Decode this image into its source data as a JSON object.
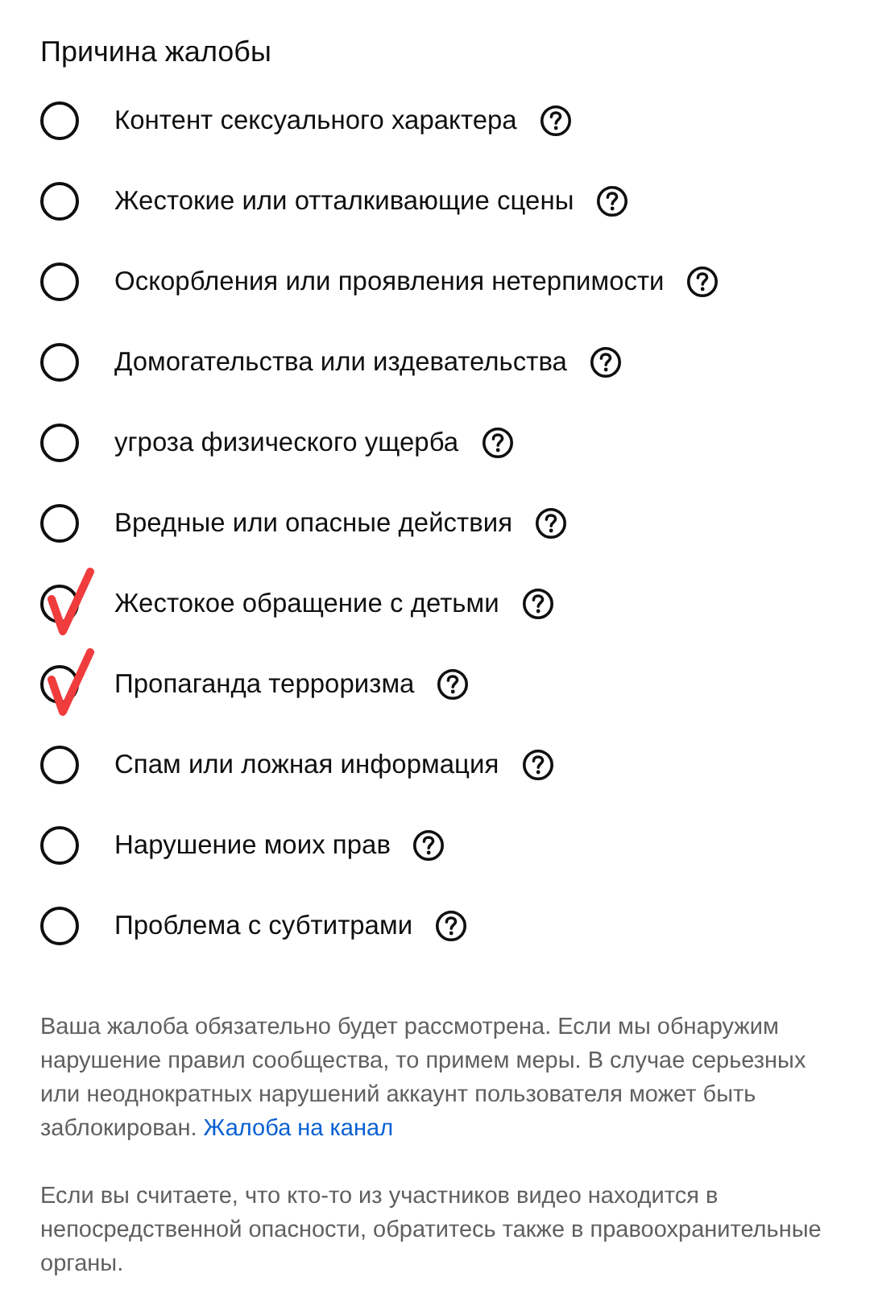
{
  "title": "Причина жалобы",
  "reasons": [
    {
      "label": "Контент сексуального характера",
      "selected": false
    },
    {
      "label": "Жестокие или отталкивающие сцены",
      "selected": false
    },
    {
      "label": "Оскорбления или проявления нетерпимости",
      "selected": false
    },
    {
      "label": "Домогательства или издевательства",
      "selected": false
    },
    {
      "label": "угроза физического ущерба",
      "selected": false
    },
    {
      "label": "Вредные или опасные действия",
      "selected": false
    },
    {
      "label": "Жестокое обращение с детьми",
      "selected": true
    },
    {
      "label": "Пропаганда терроризма",
      "selected": true
    },
    {
      "label": "Спам или ложная информация",
      "selected": false
    },
    {
      "label": "Нарушение моих прав",
      "selected": false
    },
    {
      "label": "Проблема с субтитрами",
      "selected": false
    }
  ],
  "notice": {
    "text": "Ваша жалоба обязательно будет рассмотрена. Если мы обнаружим нарушение правил сообщества, то примем меры. В случае серьезных или неоднократных нарушений аккаунт пользователя может быть заблокирован.",
    "link": "Жалоба на канал"
  },
  "safety_note": "Если вы считаете, что кто-то из участников видео находится в непосредственной опасности, обратитесь также в правоохранительные органы."
}
